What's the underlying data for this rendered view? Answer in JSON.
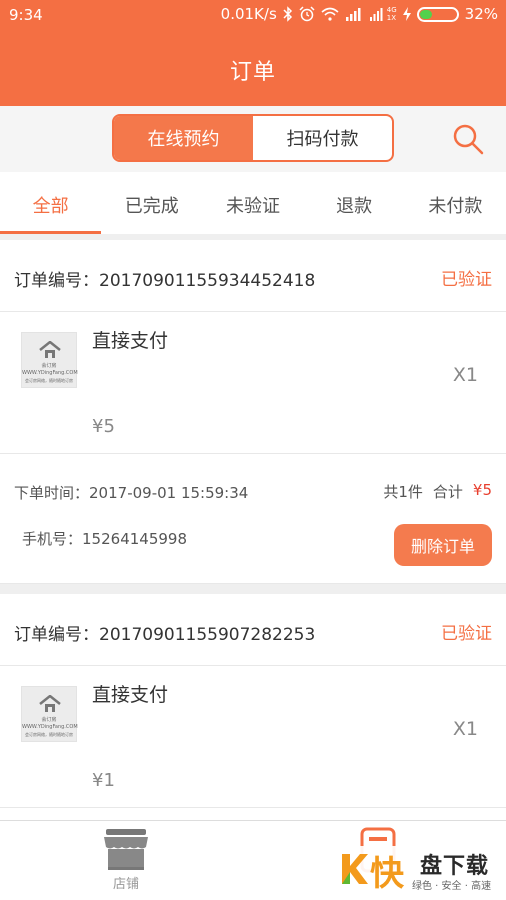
{
  "status_bar": {
    "time": "9:34",
    "speed": "0.01K/s",
    "net_top": "4G",
    "net_bottom": "1X",
    "battery_percent": "32%",
    "battery_level": 0.32
  },
  "header": {
    "title": "订单"
  },
  "segmented": {
    "options": [
      "在线预约",
      "扫码付款"
    ],
    "selected": 0
  },
  "tabs": {
    "items": [
      "全部",
      "已完成",
      "未验证",
      "退款",
      "未付款"
    ],
    "active": 0
  },
  "orders": [
    {
      "order_no_label": "订单编号：",
      "order_no": "20170901155934452418",
      "status": "已验证",
      "item_name": "直接支付",
      "qty": "X1",
      "price": "¥5",
      "thumb_brand": "会订房",
      "thumb_url": "WWW.YDingFang.COM",
      "thumb_slogan": "会订房网络，随时随地订房",
      "time_label": "下单时间：",
      "time": "2017-09-01 15:59:34",
      "count": "共1件",
      "total_label": "合计",
      "total": "¥5",
      "phone_label": "手机号：",
      "phone": "15264145998",
      "delete_label": "删除订单"
    },
    {
      "order_no_label": "订单编号：",
      "order_no": "20170901155907282253",
      "status": "已验证",
      "item_name": "直接支付",
      "qty": "X1",
      "price": "¥1",
      "thumb_brand": "会订房",
      "thumb_url": "WWW.YDingFang.COM",
      "thumb_slogan": "会订房网络，随时随地订房"
    }
  ],
  "bottom_nav": {
    "store_label": "店铺"
  },
  "watermark": {
    "fast": "快",
    "name": "盘下载",
    "slogan": "绿色 · 安全 · 高速"
  },
  "colors": {
    "accent": "#f46f43",
    "price_red": "#e83f2e",
    "battery": "#53d14c"
  }
}
